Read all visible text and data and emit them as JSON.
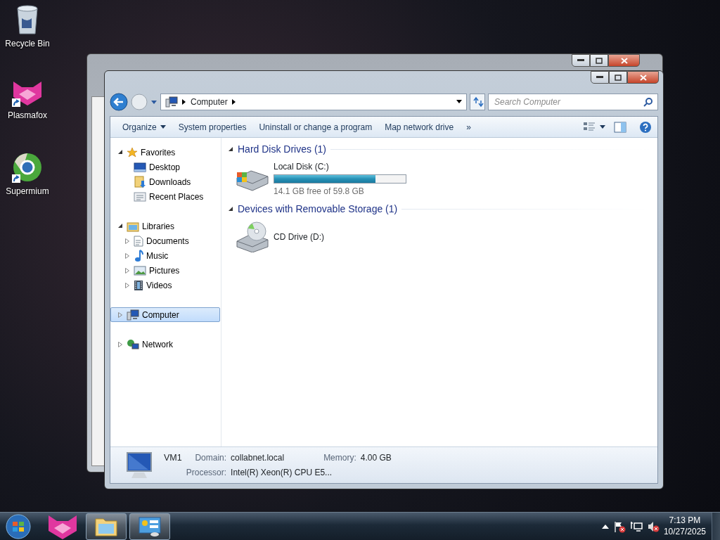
{
  "desktop_icons": [
    {
      "label": "Recycle Bin",
      "kind": "bin",
      "shortcut": false
    },
    {
      "label": "Plasmafox",
      "kind": "fox",
      "shortcut": true
    },
    {
      "label": "Supermium",
      "kind": "browser",
      "shortcut": true
    }
  ],
  "window": {
    "address": [
      "Computer"
    ],
    "search": {
      "placeholder": "Search Computer"
    },
    "toolbar": [
      {
        "label": "Organize",
        "dropdown": true
      },
      {
        "label": "System properties",
        "dropdown": false
      },
      {
        "label": "Uninstall or change a program",
        "dropdown": false
      },
      {
        "label": "Map network drive",
        "dropdown": false
      },
      {
        "label": "»",
        "dropdown": false
      }
    ],
    "nav": [
      {
        "label": "Favorites",
        "kind": "star",
        "expanded": true,
        "selected": false,
        "children": [
          {
            "label": "Desktop",
            "kind": "desktop",
            "selected": false
          },
          {
            "label": "Downloads",
            "kind": "downloads",
            "selected": false
          },
          {
            "label": "Recent Places",
            "kind": "recent",
            "selected": false
          }
        ]
      },
      {
        "label": "Libraries",
        "kind": "library",
        "expanded": true,
        "selected": false,
        "children": [
          {
            "label": "Documents",
            "kind": "document",
            "expanded": false,
            "selected": false
          },
          {
            "label": "Music",
            "kind": "music",
            "expanded": false,
            "selected": false
          },
          {
            "label": "Pictures",
            "kind": "picture",
            "expanded": false,
            "selected": false
          },
          {
            "label": "Videos",
            "kind": "video",
            "expanded": false,
            "selected": false
          }
        ]
      },
      {
        "label": "Computer",
        "kind": "computer",
        "expanded": false,
        "selected": true
      },
      {
        "label": "Network",
        "kind": "network",
        "expanded": false,
        "selected": false
      }
    ],
    "groups": [
      {
        "title": "Hard Disk Drives (1)",
        "expanded": true,
        "items": [
          {
            "name": "Local Disk (C:)",
            "kind": "disk",
            "level": 0.77,
            "free": "14.1 GB free of 59.8 GB"
          }
        ]
      },
      {
        "title": "Devices with Removable Storage (1)",
        "expanded": true,
        "items": [
          {
            "name": "CD Drive (D:)",
            "kind": "cd"
          }
        ]
      }
    ],
    "details": {
      "name": "VM1",
      "fields": [
        {
          "label": "Domain:",
          "value": "collabnet.local"
        },
        {
          "label": "Memory:",
          "value": "4.00 GB"
        },
        {
          "label": "Processor:",
          "value": "Intel(R) Xeon(R) CPU E5..."
        }
      ]
    }
  },
  "taskbar": {
    "buttons": [
      {
        "kind": "fox",
        "running": false
      },
      {
        "kind": "folder",
        "running": true
      },
      {
        "kind": "panel",
        "running": true
      }
    ],
    "clock": {
      "time": "7:13 PM",
      "date": "10/27/2025"
    }
  }
}
